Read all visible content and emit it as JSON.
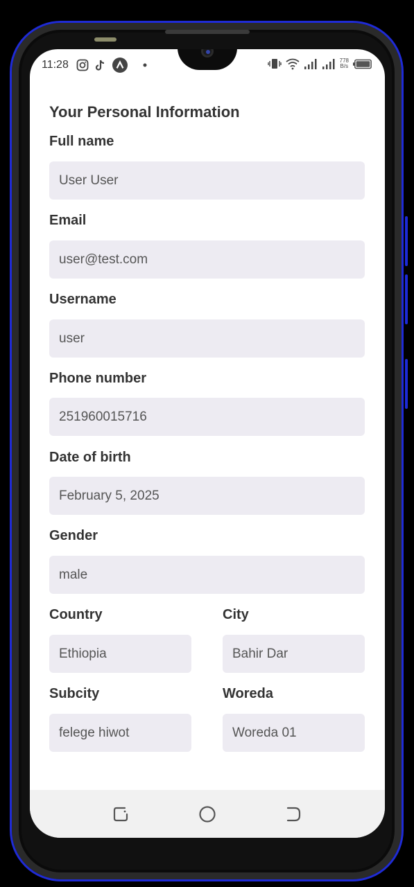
{
  "status_bar": {
    "time": "11:28",
    "left_icons": [
      "instagram-icon",
      "tiktok-icon",
      "app-icon",
      "dot-icon"
    ],
    "right_icons": [
      "vibrate-icon",
      "wifi-icon",
      "signal-icon",
      "signal-icon",
      "battery-icon"
    ],
    "speed_value": "778",
    "speed_unit": "B/s"
  },
  "form": {
    "title": "Your Personal Information",
    "full_name": {
      "label": "Full name",
      "value": "User User"
    },
    "email": {
      "label": "Email",
      "value": "user@test.com"
    },
    "username": {
      "label": "Username",
      "value": "user"
    },
    "phone": {
      "label": "Phone number",
      "value": "251960015716"
    },
    "dob": {
      "label": "Date of birth",
      "value": "February 5, 2025"
    },
    "gender": {
      "label": "Gender",
      "value": "male"
    },
    "country": {
      "label": "Country",
      "value": "Ethiopia"
    },
    "city": {
      "label": "City",
      "value": "Bahir Dar"
    },
    "subcity": {
      "label": "Subcity",
      "value": "felege hiwot"
    },
    "woreda": {
      "label": "Woreda",
      "value": "Woreda 01"
    }
  },
  "nav_bar": {
    "buttons": [
      "recent-apps-icon",
      "home-icon",
      "back-icon"
    ]
  },
  "colors": {
    "frame_accent": "#1f2bd6",
    "input_background": "#edebf2",
    "label_text": "#333333"
  }
}
